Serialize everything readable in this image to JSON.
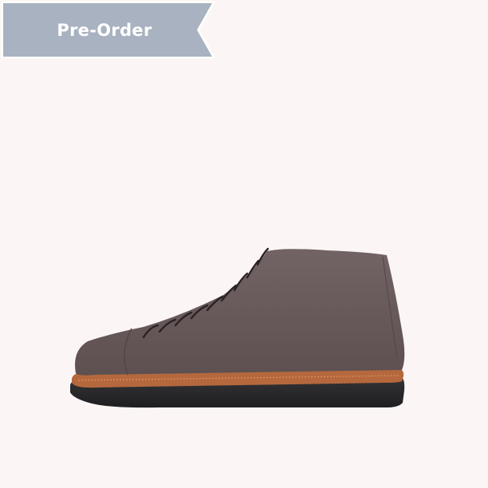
{
  "badge": {
    "label": "Pre-Order",
    "color": "#a9b2c0"
  },
  "product": {
    "image_icon": "boot-image"
  },
  "colors": {
    "background": "#fbf6f5",
    "suede": "#6a5b5c",
    "welt": "#b5683d",
    "sole": "#262628"
  }
}
